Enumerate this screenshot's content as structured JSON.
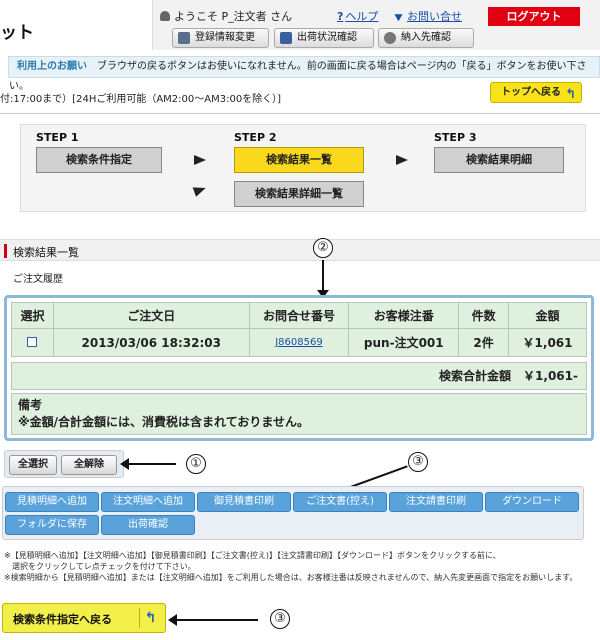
{
  "header": {
    "logo_fragment": "ット",
    "welcome": "ようこそ P_注文者 さん",
    "help": "ヘルプ",
    "contact": "お問い合せ",
    "logout": "ログアウト",
    "buttons": {
      "registration": "登録情報変更",
      "shipping_status": "出荷状況確認",
      "delivery_confirm": "納入先確認"
    }
  },
  "notice": {
    "label": "利用上のお願い",
    "text": "ブラウザの戻るボタンはお使いになれません。前の画面に戻る場合はページ内の「戻る」ボタンをお使い下さい。"
  },
  "hours": "付:17:00まで）[24Hご利用可能（AM2:00〜AM3:00を除く）]",
  "top_back": "トップへ戻る",
  "steps": {
    "step1_title": "STEP 1",
    "step1_button": "検索条件指定",
    "step2_title": "STEP 2",
    "step2_button": "検索結果一覧",
    "step2_sub_button": "検索結果詳細一覧",
    "step3_title": "STEP 3",
    "step3_button": "検索結果明細"
  },
  "results": {
    "heading": "検索結果一覧",
    "history": "ご注文履歴",
    "columns": [
      "選択",
      "ご注文日",
      "お問合せ番号",
      "お客様注番",
      "件数",
      "金額"
    ],
    "rows": [
      {
        "date": "2013/03/06 18:32:03",
        "inquiry_no": "J8608569",
        "customer_no": "pun-注文001",
        "count": "2件",
        "amount": "￥1,061"
      }
    ],
    "total_label": "検索合計金額",
    "total_value": "￥1,061-",
    "remarks_title": "備考",
    "remarks_text": "※金額/合計金額には、消費税は含まれておりません。"
  },
  "select_buttons": {
    "select_all": "全選択",
    "deselect_all": "全解除"
  },
  "actions": {
    "row1": [
      "見積明細へ追加",
      "注文明細へ追加",
      "御見積書印刷",
      "ご注文書(控え)",
      "注文請書印刷",
      "ダウンロード"
    ],
    "row2": [
      "フォルダに保存",
      "出荷確認"
    ]
  },
  "footnotes": [
    "※【見積明細へ追加】【注文明細へ追加】【御見積書印刷】【ご注文書(控え)】【注文請書印刷】【ダウンロード】ボタンをクリックする前に、",
    "　選択をクリックしてレ点チェックを付けて下さい。",
    "※検索明細から【見積明細へ追加】または【注文明細へ追加】をご利用した場合は、お客様注番は反映されませんので、納入先変更画面で指定をお願いします。"
  ],
  "bottom_back": "検索条件指定へ戻る",
  "annotations": {
    "a1": "①",
    "a2": "②",
    "a3": "③",
    "a3b": "③"
  }
}
